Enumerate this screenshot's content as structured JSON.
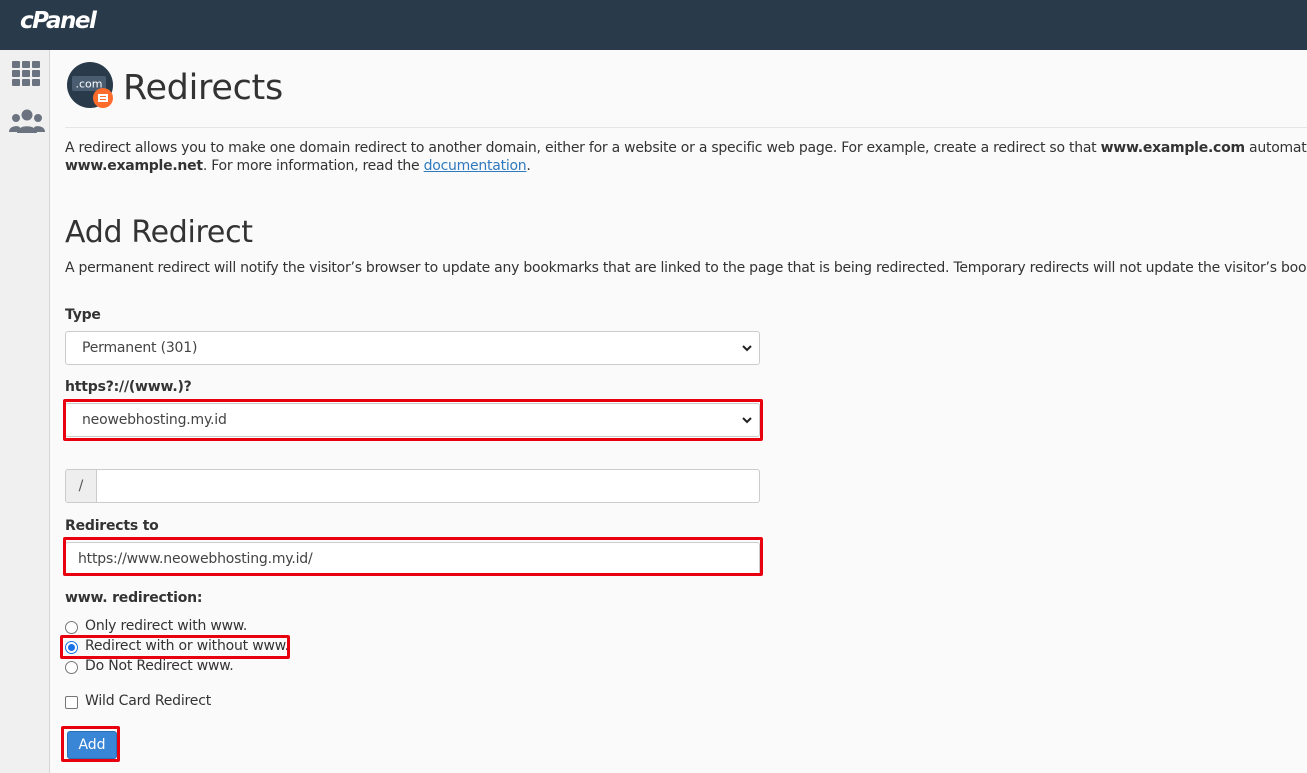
{
  "header": {
    "brand": "cPanel"
  },
  "sidebar": {
    "items": [
      {
        "icon": "grid-icon"
      },
      {
        "icon": "users-icon"
      }
    ]
  },
  "page": {
    "icon_text": ".com",
    "title": "Redirects",
    "intro": {
      "part1": "A redirect allows you to make one domain redirect to another domain, either for a website or a specific web page. For example, create a redirect so that ",
      "domain1": "www.example.com",
      "part2": " automatically redi",
      "domain2": "www.example.net",
      "part3": ". For more information, read the ",
      "link": "documentation",
      "part4": "."
    }
  },
  "form": {
    "section_title": "Add Redirect",
    "section_desc": "A permanent redirect will notify the visitor’s browser to update any bookmarks that are linked to the page that is being redirected. Temporary redirects will not update the visitor’s bookmarks.",
    "type_label": "Type",
    "type_value": "Permanent (301)",
    "domain_label": "https?://(www.)?",
    "domain_value": "neowebhosting.my.id",
    "path_prefix": "/",
    "path_value": "",
    "redirect_label": "Redirects to",
    "redirect_value": "https://www.neowebhosting.my.id/",
    "www_label": "www. redirection:",
    "www_options": [
      {
        "label": "Only redirect with www.",
        "checked": false
      },
      {
        "label": "Redirect with or without www.",
        "checked": true
      },
      {
        "label": "Do Not Redirect www.",
        "checked": false
      }
    ],
    "wildcard_label": "Wild Card Redirect",
    "wildcard_checked": false,
    "add_button": "Add"
  },
  "colors": {
    "topbar": "#293a4a",
    "highlight": "#e8000f",
    "button": "#3a86d6",
    "link": "#2f7abf"
  }
}
